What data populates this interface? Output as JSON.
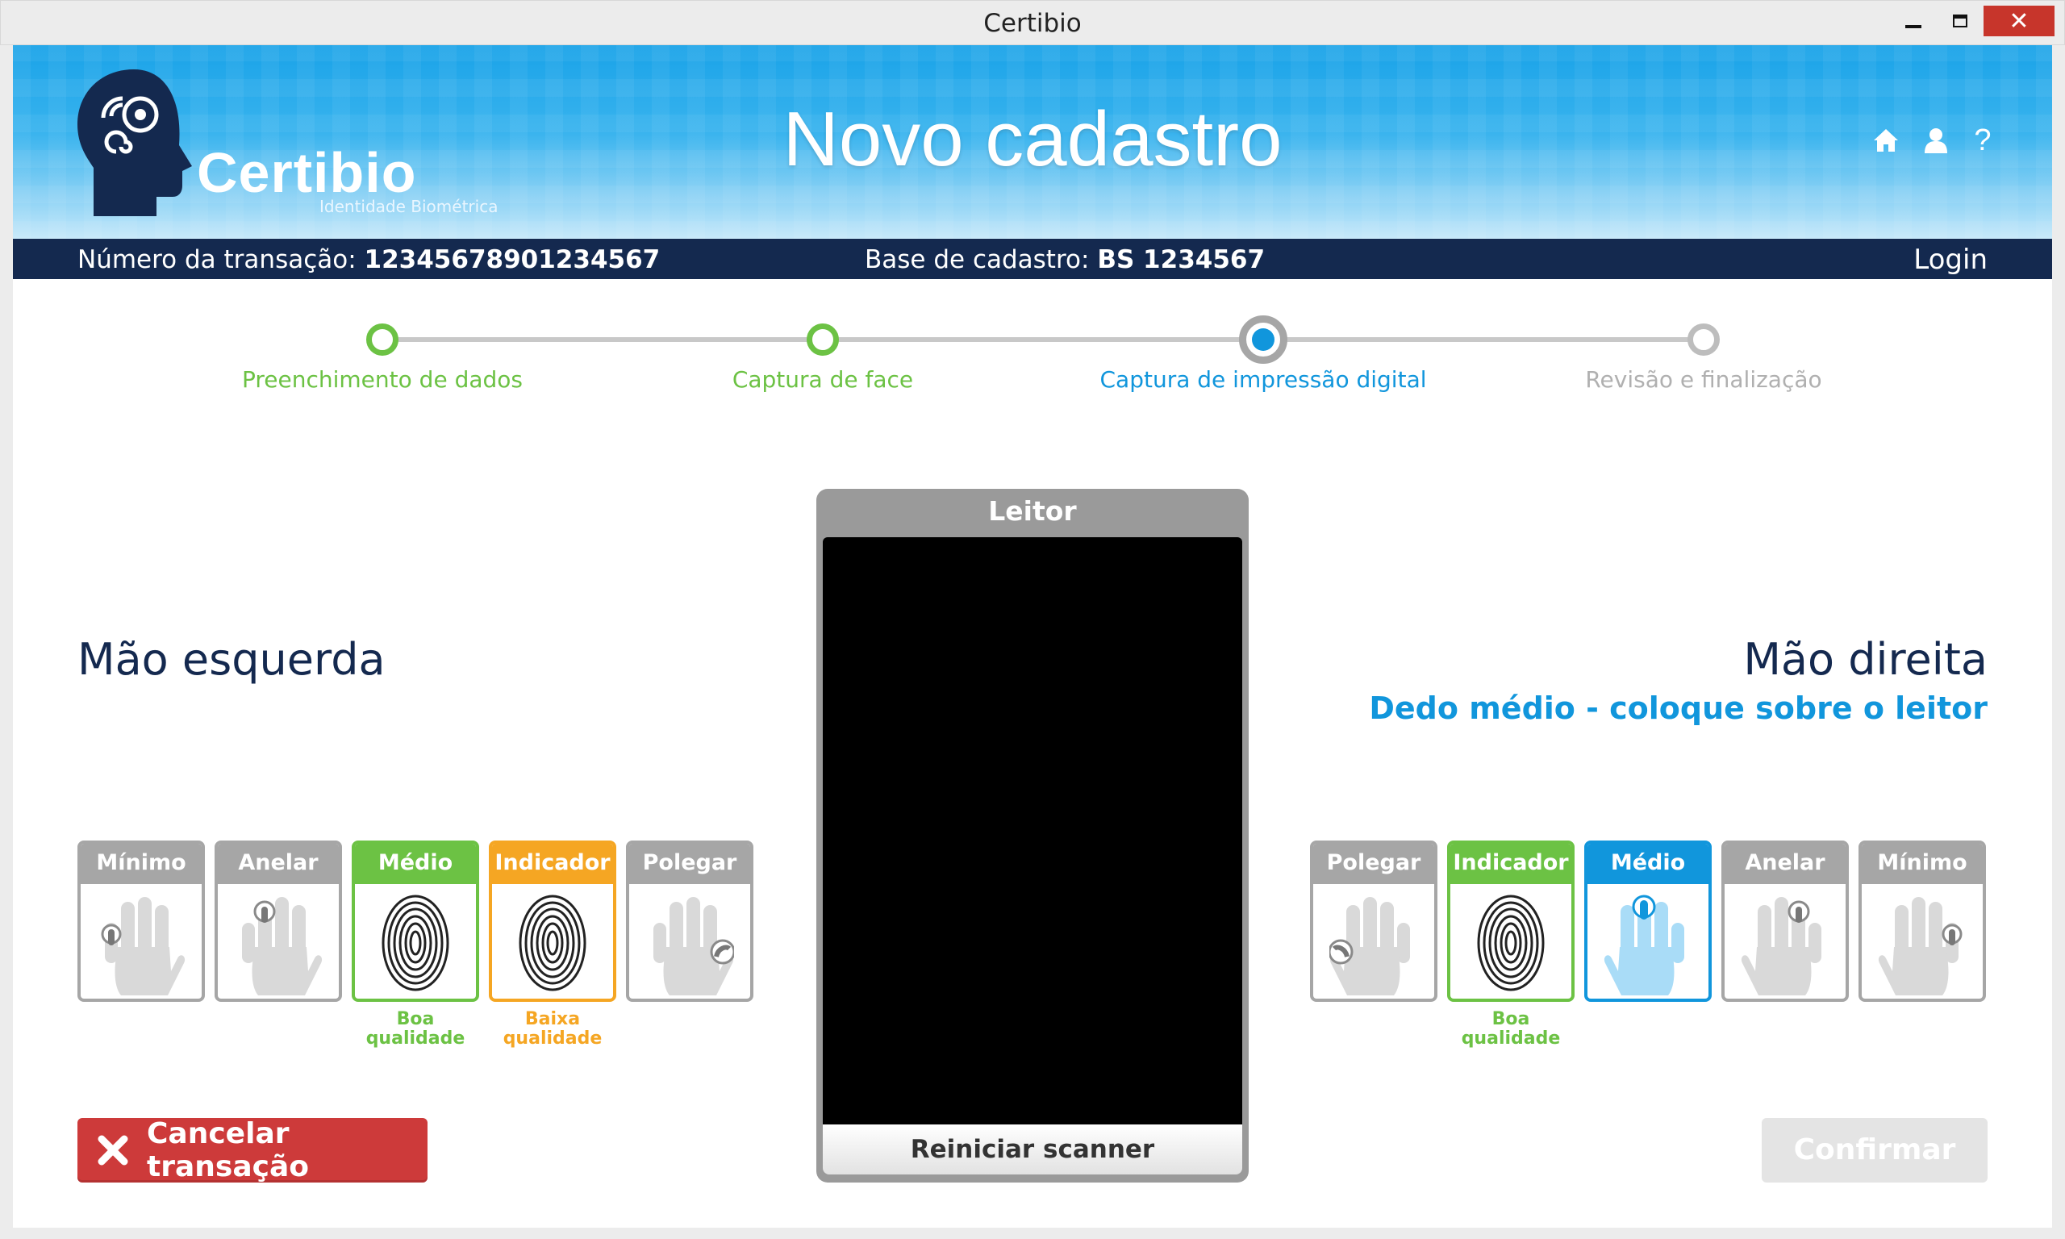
{
  "window": {
    "title": "Certibio"
  },
  "header": {
    "brand": "Certibio",
    "brand_subtitle": "Identidade Biométrica",
    "page_title": "Novo cadastro",
    "help_label": "?"
  },
  "infobar": {
    "transaction_label": "Número da transação:",
    "transaction_value": "12345678901234567",
    "base_label": "Base de cadastro:",
    "base_value": "BS 1234567",
    "login_label": "Login"
  },
  "steps": [
    {
      "label": "Preenchimento de dados",
      "state": "done"
    },
    {
      "label": "Captura de face",
      "state": "done"
    },
    {
      "label": "Captura de impressão digital",
      "state": "active"
    },
    {
      "label": "Revisão e finalização",
      "state": "todo"
    }
  ],
  "left_hand": {
    "title": "Mão esquerda",
    "fingers": [
      {
        "name": "Mínimo",
        "state": "empty"
      },
      {
        "name": "Anelar",
        "state": "empty"
      },
      {
        "name": "Médio",
        "state": "good",
        "quality": "Boa qualidade"
      },
      {
        "name": "Indicador",
        "state": "low",
        "quality": "Baixa qualidade"
      },
      {
        "name": "Polegar",
        "state": "empty"
      }
    ]
  },
  "right_hand": {
    "title": "Mão direita",
    "instruction": "Dedo médio - coloque sobre o leitor",
    "fingers": [
      {
        "name": "Polegar",
        "state": "empty"
      },
      {
        "name": "Indicador",
        "state": "good",
        "quality": "Boa qualidade"
      },
      {
        "name": "Médio",
        "state": "current"
      },
      {
        "name": "Anelar",
        "state": "empty"
      },
      {
        "name": "Mínimo",
        "state": "empty"
      }
    ]
  },
  "reader": {
    "title": "Leitor",
    "restart_label": "Reiniciar scanner"
  },
  "actions": {
    "cancel_label": "Cancelar transação",
    "confirm_label": "Confirmar"
  },
  "colors": {
    "accent": "#1196dc",
    "success": "#6cc244",
    "warning": "#f5a623",
    "danger": "#cd3a3a",
    "navy": "#14294f"
  }
}
